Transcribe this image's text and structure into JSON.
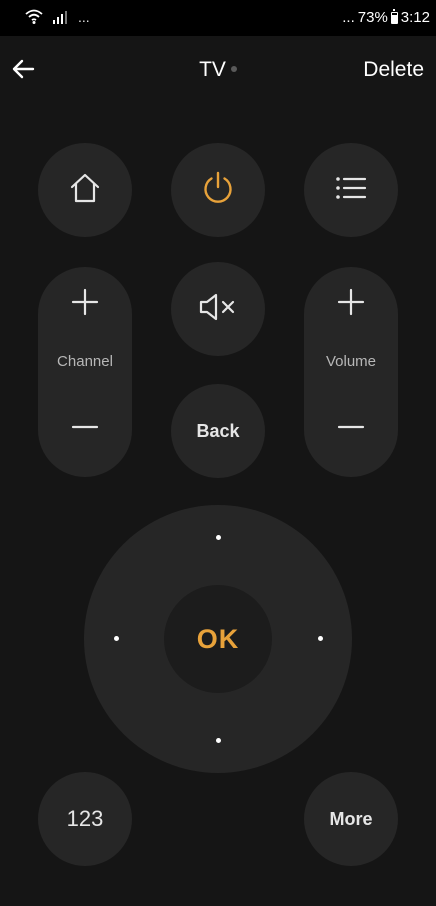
{
  "status_bar": {
    "left_dots": "...",
    "dots": "...",
    "battery": "73%",
    "time": "3:12"
  },
  "header": {
    "title": "TV",
    "delete_label": "Delete"
  },
  "remote": {
    "channel_label": "Channel",
    "volume_label": "Volume",
    "back_label": "Back",
    "ok_label": "OK",
    "numbers_label": "123",
    "more_label": "More"
  },
  "colors": {
    "accent": "#e8a23a",
    "background": "#151515",
    "button": "#262626",
    "status_dot": "#5a5a5a"
  },
  "icons": [
    "wifi-icon",
    "signal-icon",
    "battery-icon",
    "back-arrow-icon",
    "home-icon",
    "power-icon",
    "menu-list-icon",
    "plus-icon",
    "minus-icon",
    "mute-icon"
  ]
}
